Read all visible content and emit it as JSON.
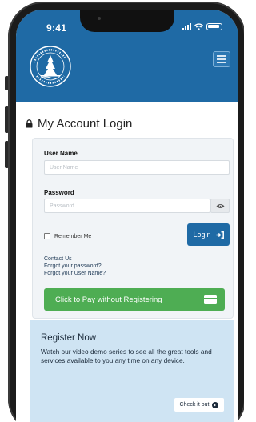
{
  "status_bar": {
    "time": "9:41"
  },
  "header": {
    "logo": {
      "icon": "city-of-bellevue-seal",
      "text_top": "CITY OF BELLEVUE",
      "text_bottom": "WASHINGTON"
    },
    "menu_icon": "hamburger-menu-icon"
  },
  "login": {
    "title": "My Account Login",
    "title_icon": "lock-icon",
    "username_label": "User Name",
    "username_placeholder": "User Name",
    "username_value": "",
    "password_label": "Password",
    "password_placeholder": "Password",
    "password_value": "",
    "show_password_icon": "eye-icon",
    "remember_label": "Remember Me",
    "remember_checked": false,
    "login_label": "Login",
    "login_icon": "sign-in-icon",
    "links": [
      "Contact Us",
      "Forgot your password?",
      "Forgot your User Name?"
    ],
    "pay_label": "Click to Pay without Registering",
    "pay_icon": "credit-card-icon"
  },
  "register": {
    "title": "Register Now",
    "text": "Watch our video demo series to see all the great tools and services available to you any time on any device.",
    "button_label": "Check it out",
    "button_icon": "arrow-circle-right-icon"
  },
  "colors": {
    "header_blue": "#1f6aa5",
    "button_blue": "#1f6aa5",
    "pay_green": "#4ead53",
    "register_bg": "#cfe4f3",
    "card_bg": "#f1f4f7"
  }
}
